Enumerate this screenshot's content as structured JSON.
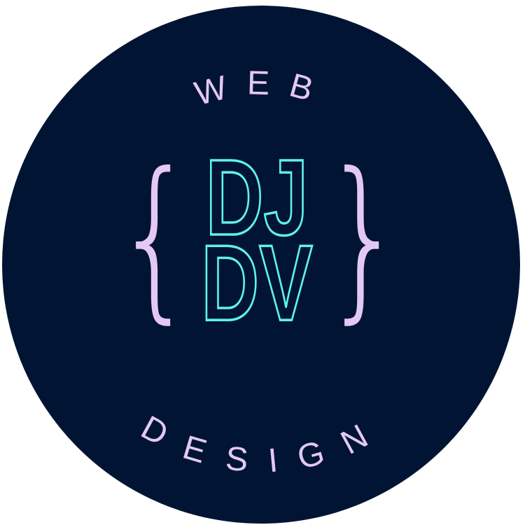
{
  "logo": {
    "top_text": "WEB",
    "bottom_text": "DESIGN",
    "brace_open": "{",
    "brace_close": "}",
    "monogram_line1": "DJ",
    "monogram_line2": "DV",
    "colors": {
      "circle": "#021433",
      "lettering": "#e3c8f5",
      "monogram": "#5ef2ea"
    }
  }
}
